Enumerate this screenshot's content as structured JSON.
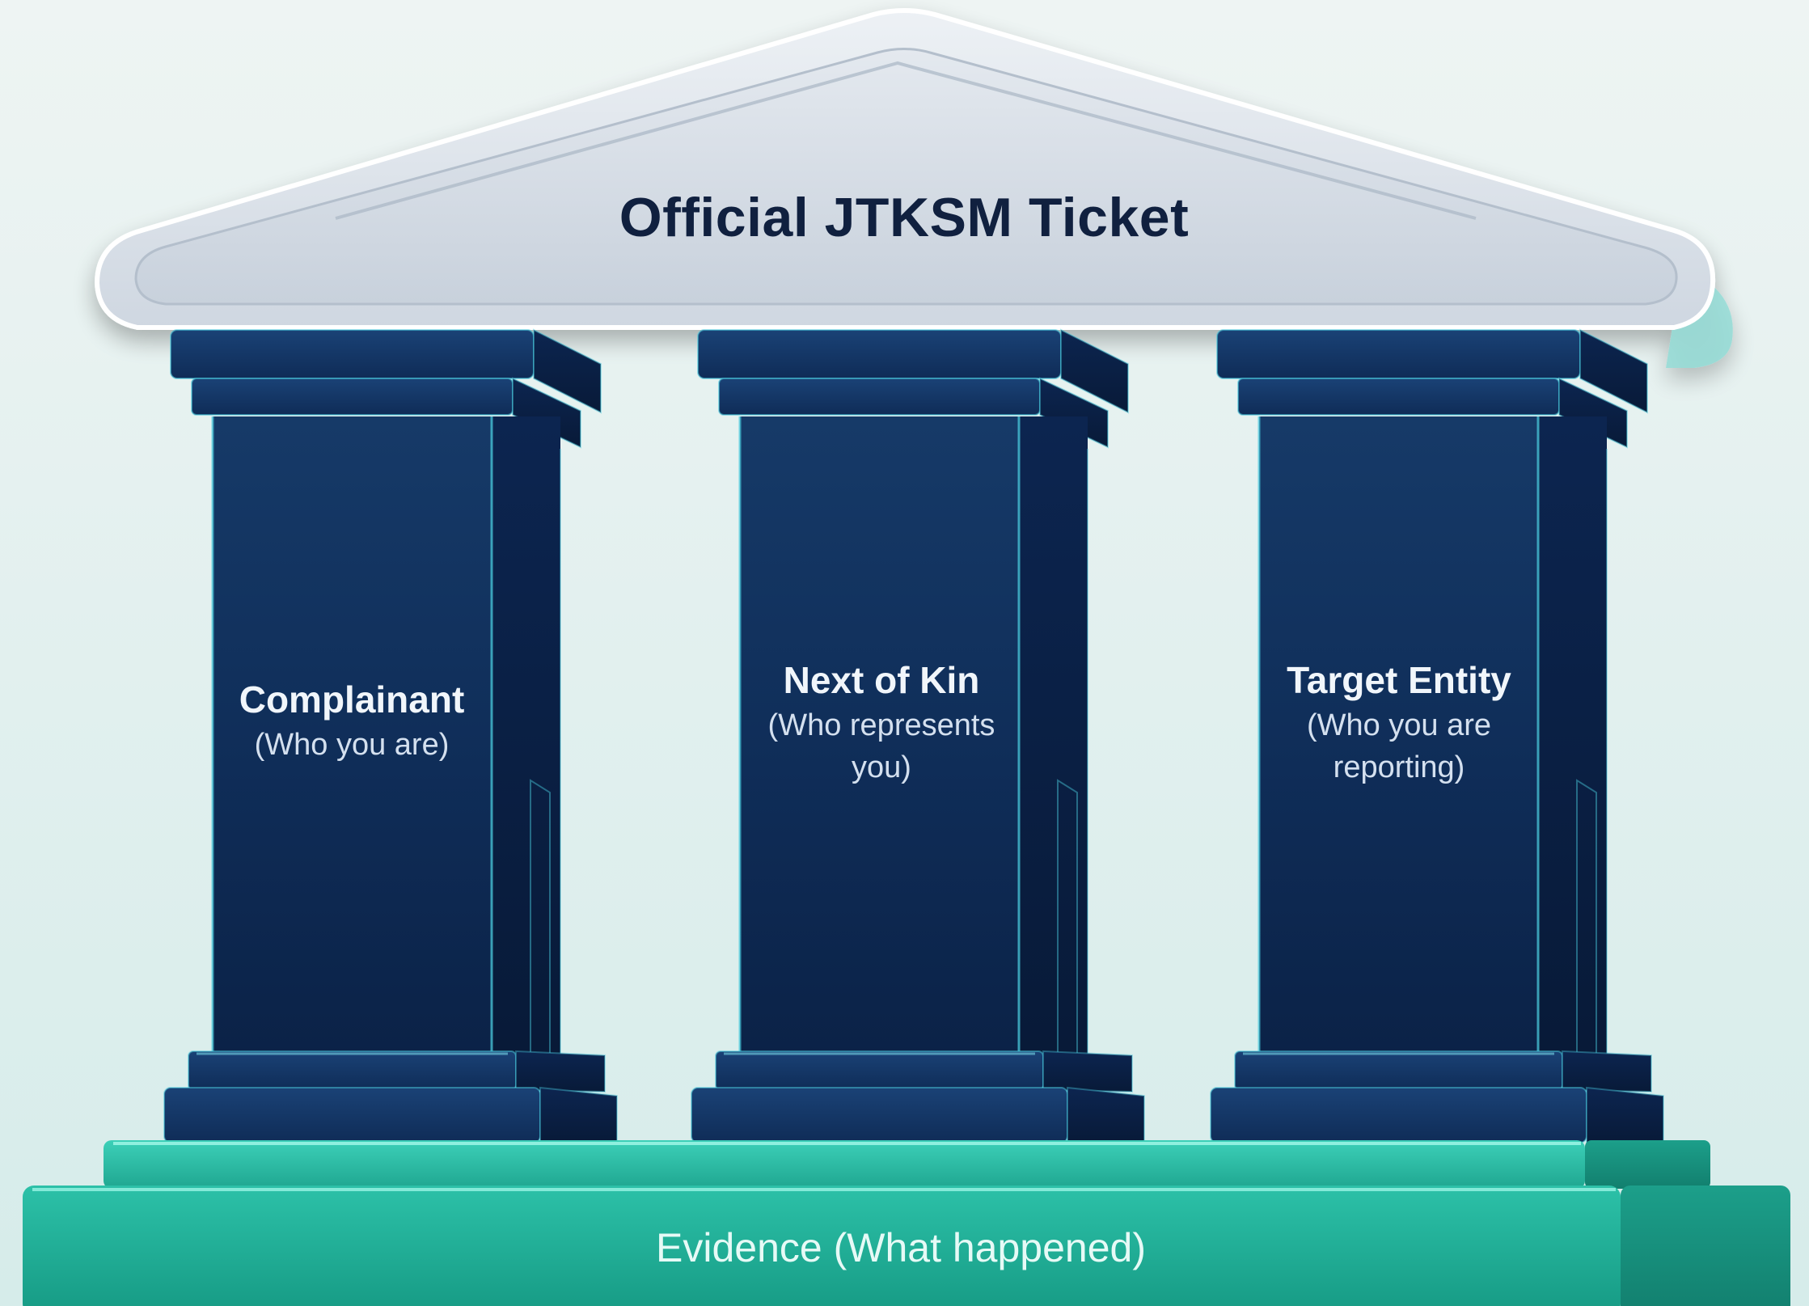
{
  "roof": {
    "title": "Official JTKSM Ticket"
  },
  "pillars": [
    {
      "title": "Complainant",
      "subtitle": "(Who you are)"
    },
    {
      "title": "Next of Kin",
      "subtitle_line1": "(Who represents",
      "subtitle_line2": "you)"
    },
    {
      "title": "Target Entity",
      "subtitle_line1": "(Who you are",
      "subtitle_line2": "reporting)"
    }
  ],
  "foundation": {
    "label": "Evidence (What happened)"
  },
  "colors": {
    "background": "#e3f0ef",
    "roof": "#dfe5ec",
    "pillar_face": "#10305c",
    "pillar_dark": "#0a1f40",
    "glow": "#3ec6d6",
    "foundation": "#1ea892",
    "title_text": "#10203f"
  }
}
